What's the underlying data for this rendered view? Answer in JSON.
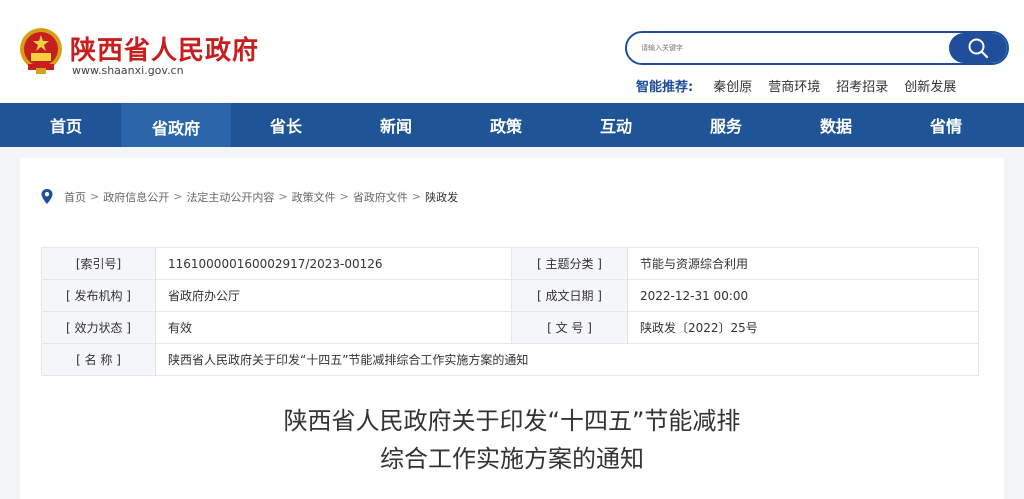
{
  "header": {
    "site_title": "陕西省人民政府",
    "site_url": "www.shaanxi.gov.cn",
    "search_placeholder": "请输入关键字",
    "smart_label": "智能推荐:",
    "smart_links": [
      "秦创原",
      "营商环境",
      "招考招录",
      "创新发展"
    ]
  },
  "nav": {
    "items": [
      "首页",
      "省政府",
      "省长",
      "新闻",
      "政策",
      "互动",
      "服务",
      "数据",
      "省情"
    ],
    "active": "省政府"
  },
  "breadcrumb": [
    "首页",
    "政府信息公开",
    "法定主动公开内容",
    "政策文件",
    "省政府文件",
    "陕政发"
  ],
  "info": {
    "index_label": "[索引号]",
    "index_value": "116100000160002917/2023-00126",
    "topic_label": "[ 主题分类 ]",
    "topic_value": "节能与资源综合利用",
    "issuer_label": "[ 发布机构 ]",
    "issuer_value": "省政府办公厅",
    "date_label": "[ 成文日期 ]",
    "date_value": "2022-12-31 00:00",
    "status_label": "[ 效力状态 ]",
    "status_value": "有效",
    "docno_label": "[ 文 号 ]",
    "docno_value": "陕政发〔2022〕25号",
    "name_label": "[ 名 称 ]",
    "name_value": "陕西省人民政府关于印发“十四五”节能减排综合工作实施方案的通知"
  },
  "document": {
    "title_line1": "陕西省人民政府关于印发“十四五”节能减排",
    "title_line2": "综合工作实施方案的通知"
  },
  "colors": {
    "brand_red": "#c81e1e",
    "nav_blue": "#1f5596",
    "nav_active": "#2b66ab",
    "search_blue": "#1f4e9a"
  }
}
